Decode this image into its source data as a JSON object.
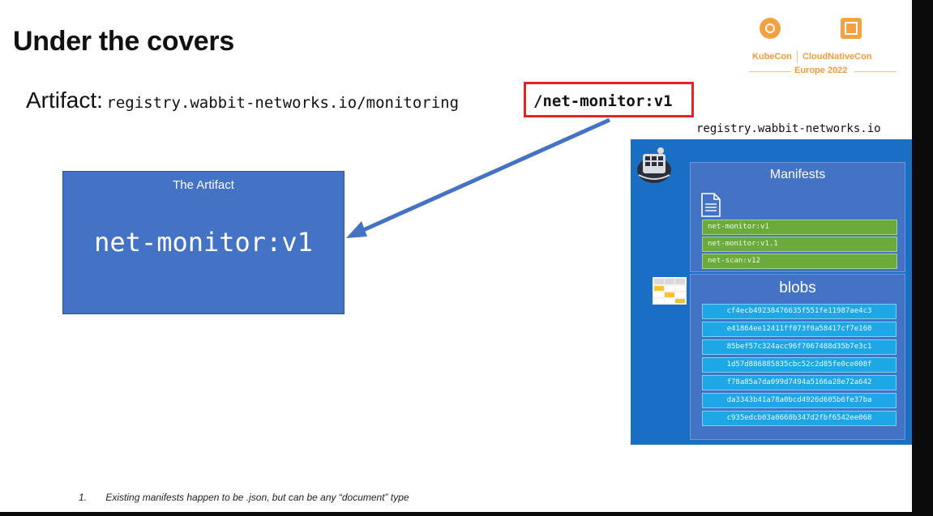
{
  "slide": {
    "title": "Under the covers",
    "logo": {
      "left_brand": "KubeCon",
      "right_brand": "CloudNativeCon",
      "event": "Europe 2022"
    },
    "artifact": {
      "label": "Artifact:",
      "path_prefix": "registry.wabbit-networks.io/monitoring",
      "path_suffix": "/net-monitor:v1"
    },
    "artifact_box": {
      "title": "The Artifact",
      "name": "net-monitor:v1"
    },
    "registry": {
      "label": "registry.wabbit-networks.io",
      "manifests": {
        "title": "Manifests",
        "items": [
          "net-monitor:v1",
          "net-monitor:v1.1",
          "net-scan:v12"
        ]
      },
      "blobs": {
        "title": "blobs",
        "items": [
          "cf4ecb49238476635f551fe11987ae4c3",
          "e41864ee12411ff073f0a58417cf7e160",
          "85bef57c324acc96f7067488d35b7e3c1",
          "1d57d886885835cbc52c2d85fe0ce008f",
          "f78a85a7da099d7494a5166a28e72a642",
          "da3343b41a78a0bcd4926d605b6fe37ba",
          "c935edcb03a0660b347d2fbf6542ee068"
        ]
      }
    },
    "footnote": {
      "number": "1.",
      "text": "Existing manifests happen to be .json, but can be any “document” type"
    }
  },
  "colors": {
    "artifact_box": "#4472c4",
    "registry_bg": "#1a6fc4",
    "manifest_row": "#6aab3c",
    "blob_row": "#1ea7e6",
    "highlight_border": "#e32527",
    "arrow": "#4472c4",
    "brand_orange": "#f39b3a"
  },
  "icons": {
    "registry": "registry-whale-icon",
    "manifests": "document-icon",
    "blobs": "table-icon"
  }
}
